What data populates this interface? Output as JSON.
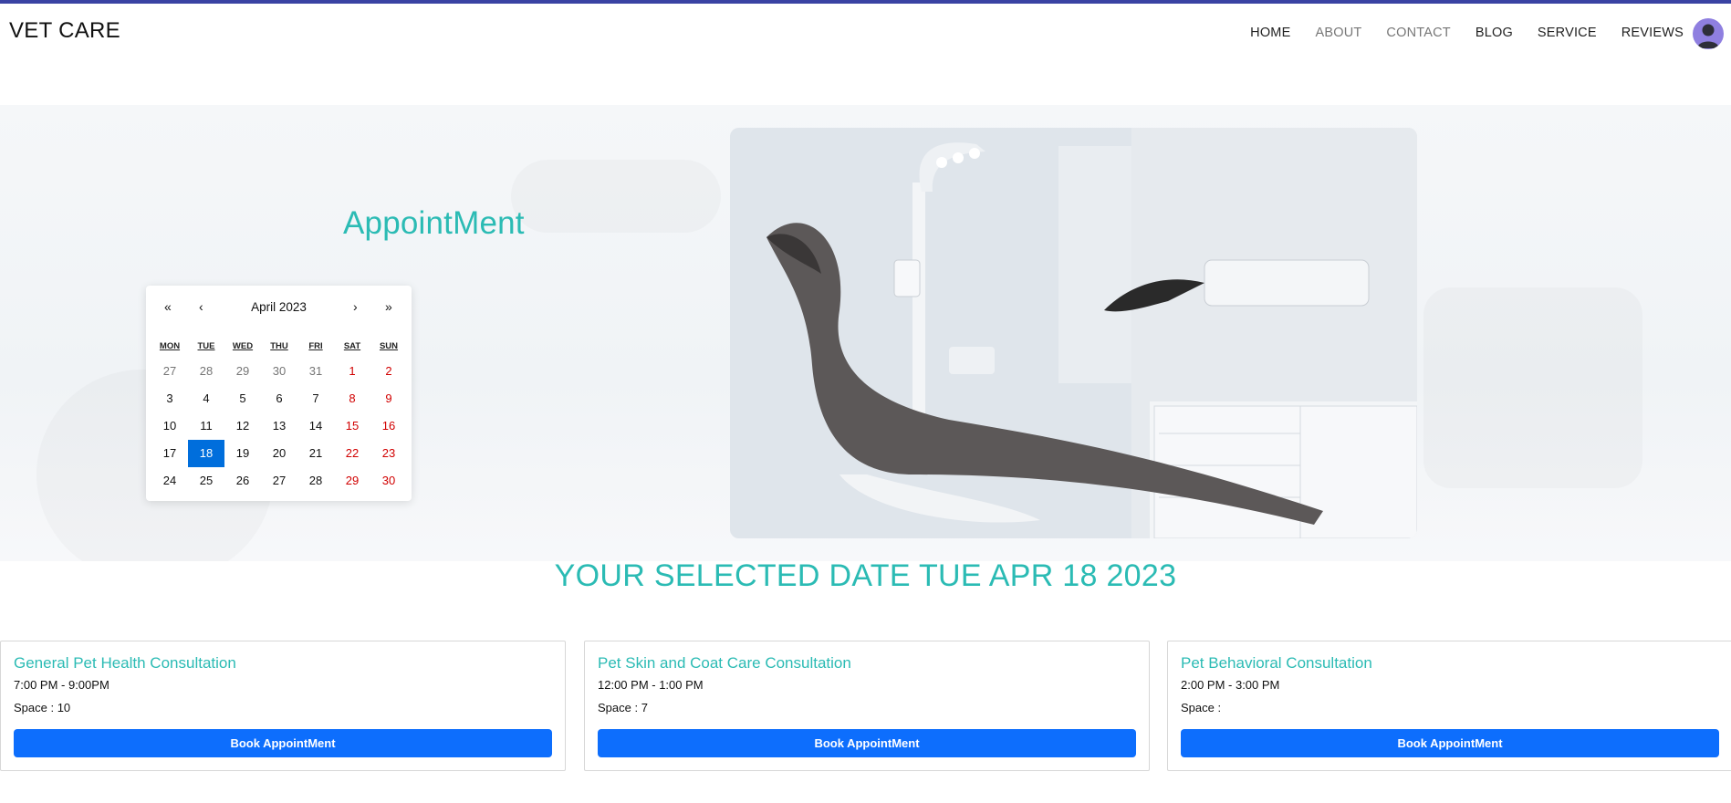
{
  "header": {
    "brand": "VET CARE",
    "nav": [
      "HOME",
      "ABOUT",
      "CONTACT",
      "BLOG",
      "SERVICE",
      "REVIEWS"
    ]
  },
  "hero": {
    "title": "AppointMent"
  },
  "calendar": {
    "nav_first": "«",
    "nav_prev": "‹",
    "month_label": "April 2023",
    "nav_next": "›",
    "nav_last": "»",
    "weekdays": [
      "MON",
      "TUE",
      "WED",
      "THU",
      "FRI",
      "SAT",
      "SUN"
    ],
    "weeks": [
      [
        "27",
        "28",
        "29",
        "30",
        "31",
        "1",
        "2"
      ],
      [
        "3",
        "4",
        "5",
        "6",
        "7",
        "8",
        "9"
      ],
      [
        "10",
        "11",
        "12",
        "13",
        "14",
        "15",
        "16"
      ],
      [
        "17",
        "18",
        "19",
        "20",
        "21",
        "22",
        "23"
      ],
      [
        "24",
        "25",
        "26",
        "27",
        "28",
        "29",
        "30"
      ]
    ],
    "selected_day": "18"
  },
  "selected_date_text": "YOUR SELECTED DATE TUE APR 18 2023",
  "appointments": [
    {
      "title": "General Pet Health Consultation",
      "time": "7:00 PM - 9:00PM",
      "space": "Space : 10",
      "button": "Book AppointMent"
    },
    {
      "title": "Pet Skin and Coat Care Consultation",
      "time": "12:00 PM - 1:00 PM",
      "space": "Space : 7",
      "button": "Book AppointMent"
    },
    {
      "title": "Pet Behavioral Consultation",
      "time": "2:00 PM - 3:00 PM",
      "space": "Space :",
      "button": "Book AppointMent"
    }
  ],
  "colors": {
    "accent": "#2bbbb4",
    "primary_button": "#0d6efd",
    "calendar_selected": "#006edc",
    "weekend": "#d10000",
    "top_bar": "#3a43a3"
  }
}
